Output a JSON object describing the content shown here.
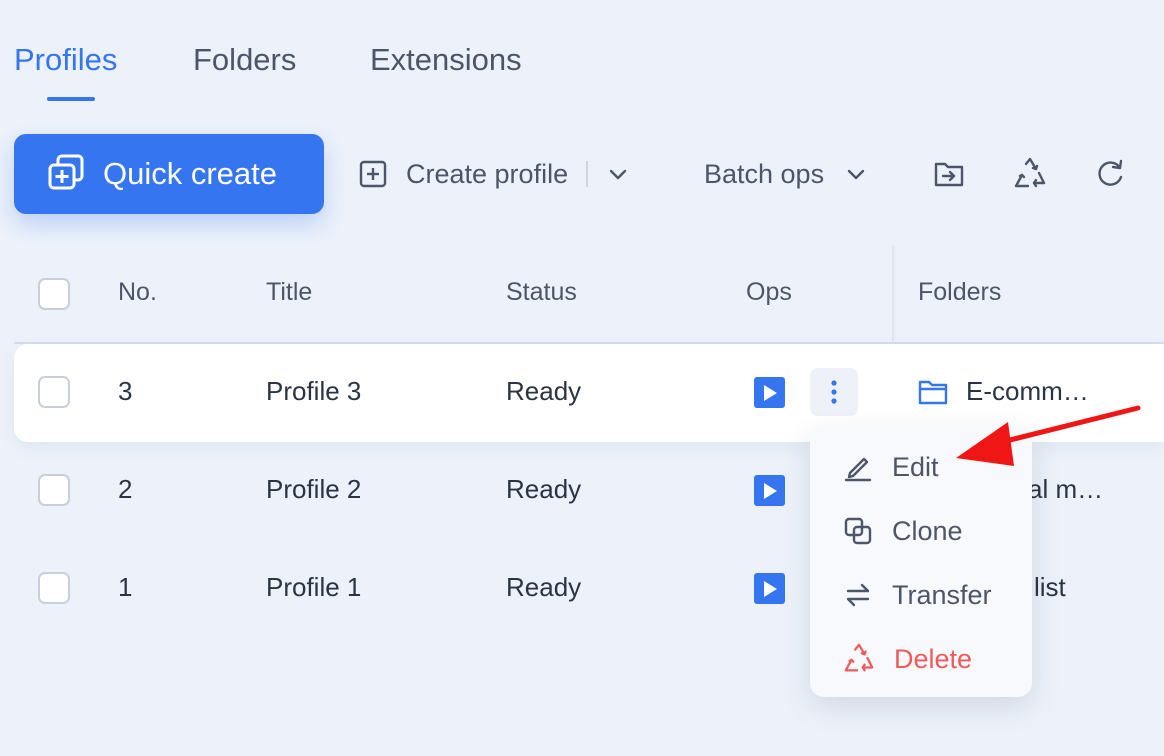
{
  "tabs": [
    {
      "label": "Profiles",
      "active": true
    },
    {
      "label": "Folders",
      "active": false
    },
    {
      "label": "Extensions",
      "active": false
    }
  ],
  "toolbar": {
    "quick_create": "Quick create",
    "create_profile": "Create profile",
    "batch_ops": "Batch ops",
    "icons": [
      "move-to-folder-icon",
      "recycle-icon",
      "refresh-icon"
    ]
  },
  "table": {
    "headers": {
      "no": "No.",
      "title": "Title",
      "status": "Status",
      "ops": "Ops",
      "folders": "Folders"
    },
    "rows": [
      {
        "no": "3",
        "title": "Profile 3",
        "status": "Ready",
        "folder": "E-comm…"
      },
      {
        "no": "2",
        "title": "Profile 2",
        "status": "Ready",
        "folder": "al m…"
      },
      {
        "no": "1",
        "title": "Profile 1",
        "status": "Ready",
        "folder": "list"
      }
    ]
  },
  "menu": {
    "items": [
      {
        "label": "Edit",
        "icon": "pencil-icon"
      },
      {
        "label": "Clone",
        "icon": "clone-icon"
      },
      {
        "label": "Transfer",
        "icon": "transfer-icon"
      },
      {
        "label": "Delete",
        "icon": "recycle-delete-icon"
      }
    ]
  },
  "colors": {
    "accent": "#3575f0",
    "danger": "#ef5b5b",
    "annotation": "#f01616"
  }
}
